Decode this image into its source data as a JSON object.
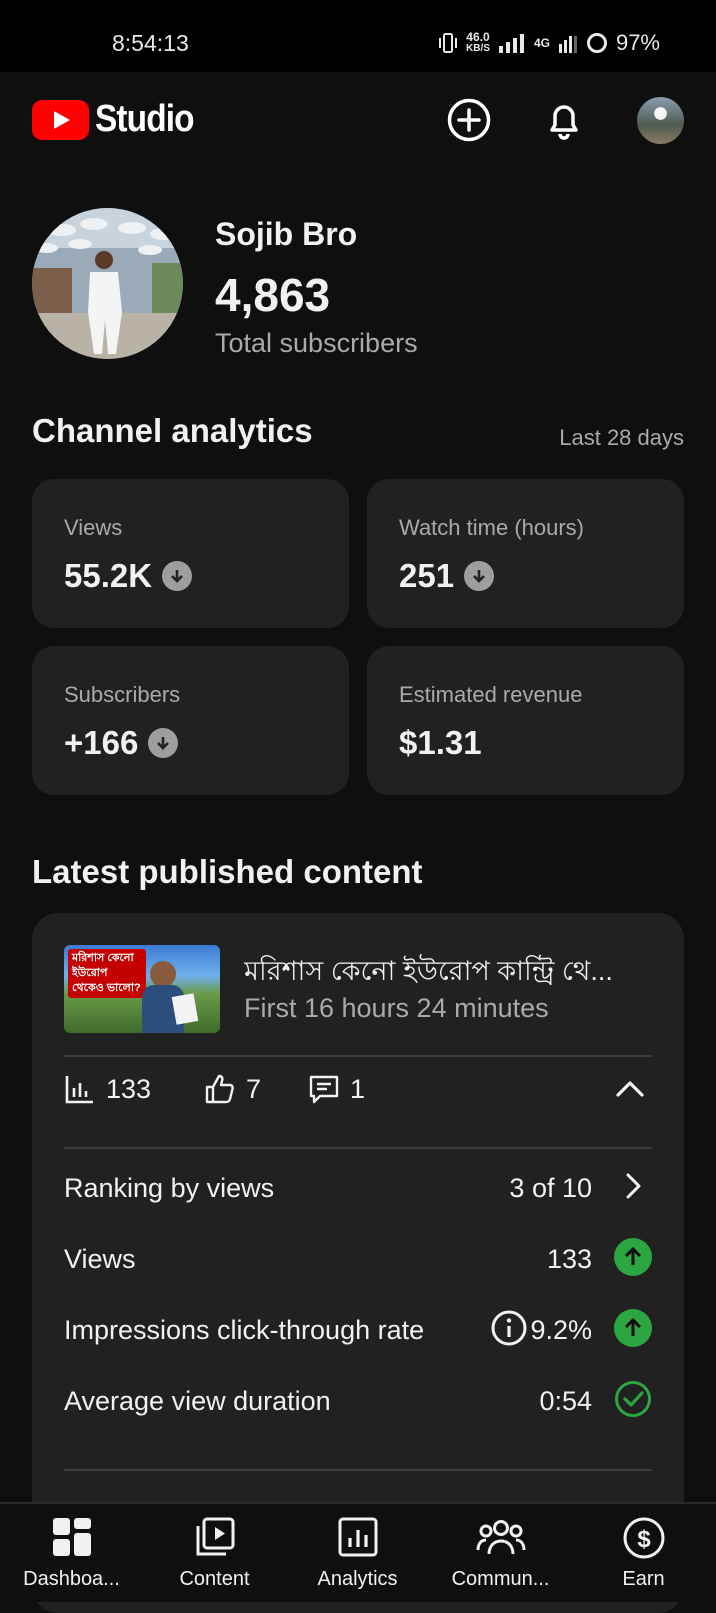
{
  "status_bar": {
    "time": "8:54:13",
    "net_speed_value": "46.0",
    "net_speed_unit": "KB/S",
    "network": "4G",
    "battery": "97%"
  },
  "app_bar": {
    "logo_text": "Studio",
    "icons": [
      "create-icon",
      "notifications-icon",
      "account-avatar"
    ]
  },
  "channel": {
    "name": "Sojib Bro",
    "subscribers": "4,863",
    "subscribers_label": "Total subscribers"
  },
  "analytics": {
    "title": "Channel analytics",
    "range": "Last 28 days",
    "cards": [
      {
        "label": "Views",
        "value": "55.2K",
        "trend": "down"
      },
      {
        "label": "Watch time (hours)",
        "value": "251",
        "trend": "down"
      },
      {
        "label": "Subscribers",
        "value": "+166",
        "trend": "down"
      },
      {
        "label": "Estimated revenue",
        "value": "$1.31",
        "trend": "none"
      }
    ]
  },
  "latest": {
    "title": "Latest published content",
    "video": {
      "thumbnail_text": "মরিশাস কেনো ইউরোপ থেকেও ভালো?",
      "title": "মরিশাস কেনো ইউরোপ কান্ট্রি থে...",
      "subtitle": "First 16 hours 24 minutes",
      "views": "133",
      "likes": "7",
      "comments": "1"
    },
    "rows": [
      {
        "label": "Ranking by views",
        "value": "3 of 10",
        "icon": "chevron-right-icon"
      },
      {
        "label": "Views",
        "value": "133",
        "icon": "arrow-up-icon"
      },
      {
        "label": "Impressions click-through rate",
        "value": "9.2%",
        "icon": "arrow-up-icon"
      },
      {
        "label": "Average view duration",
        "value": "0:54",
        "icon": "check-circle-icon"
      }
    ]
  },
  "bottom_nav": [
    {
      "label": "Dashboa...",
      "icon": "dashboard-icon"
    },
    {
      "label": "Content",
      "icon": "content-icon"
    },
    {
      "label": "Analytics",
      "icon": "analytics-icon"
    },
    {
      "label": "Commun...",
      "icon": "community-icon"
    },
    {
      "label": "Earn",
      "icon": "earn-icon"
    }
  ],
  "colors": {
    "background": "#0f0f0f",
    "card": "#212121",
    "brand_red": "#ff0000",
    "up_green": "#2ba640",
    "muted": "#aaaaaa"
  }
}
